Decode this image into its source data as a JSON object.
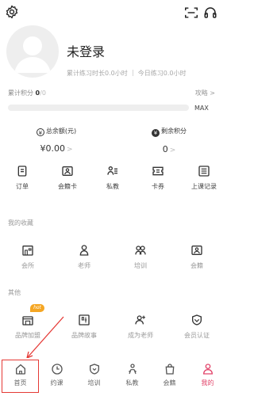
{
  "header": {
    "settings_icon": "gear-icon",
    "scan_icon": "scan-icon",
    "service_icon": "headset-icon"
  },
  "profile": {
    "avatar_icon": "user-avatar-icon",
    "username": "未登录",
    "total_practice": "累计练习时长0.0小时",
    "today_practice": "今日练习0.0小时"
  },
  "points": {
    "label_prefix": "累计积分",
    "current": "0",
    "max_suffix": "/0",
    "guide_link": "攻略 >",
    "max_label": "MAX",
    "progress_fraction": 0
  },
  "balances": {
    "total_balance": {
      "title": "总余额(元)",
      "value": "¥0.00",
      "arrow": ">"
    },
    "remaining_points": {
      "title": "剩余积分",
      "value": "0",
      "arrow": ">"
    }
  },
  "quick_actions": [
    {
      "label": "订单",
      "icon": "order-icon"
    },
    {
      "label": "会籍卡",
      "icon": "membership-card-icon"
    },
    {
      "label": "私教",
      "icon": "private-coach-icon"
    },
    {
      "label": "卡券",
      "icon": "coupon-icon"
    },
    {
      "label": "上课记录",
      "icon": "class-record-icon"
    }
  ],
  "favorites": {
    "title": "我的收藏",
    "items": [
      {
        "label": "会所",
        "icon": "club-icon"
      },
      {
        "label": "老师",
        "icon": "teacher-icon"
      },
      {
        "label": "培训",
        "icon": "training-icon"
      },
      {
        "label": "会籍",
        "icon": "membership-icon"
      }
    ]
  },
  "others": {
    "title": "其他",
    "hot_badge": "hot",
    "items": [
      {
        "label": "品牌加盟",
        "icon": "brand-join-icon"
      },
      {
        "label": "品牌故事",
        "icon": "brand-story-icon"
      },
      {
        "label": "成为老师",
        "icon": "become-teacher-icon"
      },
      {
        "label": "会员认证",
        "icon": "member-verify-icon"
      }
    ]
  },
  "tabbar": [
    {
      "label": "首页",
      "icon": "home-icon"
    },
    {
      "label": "约课",
      "icon": "schedule-icon"
    },
    {
      "label": "培训",
      "icon": "training-tab-icon"
    },
    {
      "label": "私教",
      "icon": "coach-tab-icon"
    },
    {
      "label": "会籍",
      "icon": "bag-icon"
    },
    {
      "label": "我的",
      "icon": "profile-tab-icon"
    }
  ],
  "colors": {
    "accent": "#e2446a",
    "annotation": "#e53935",
    "hot_badge": "#f5a623"
  }
}
